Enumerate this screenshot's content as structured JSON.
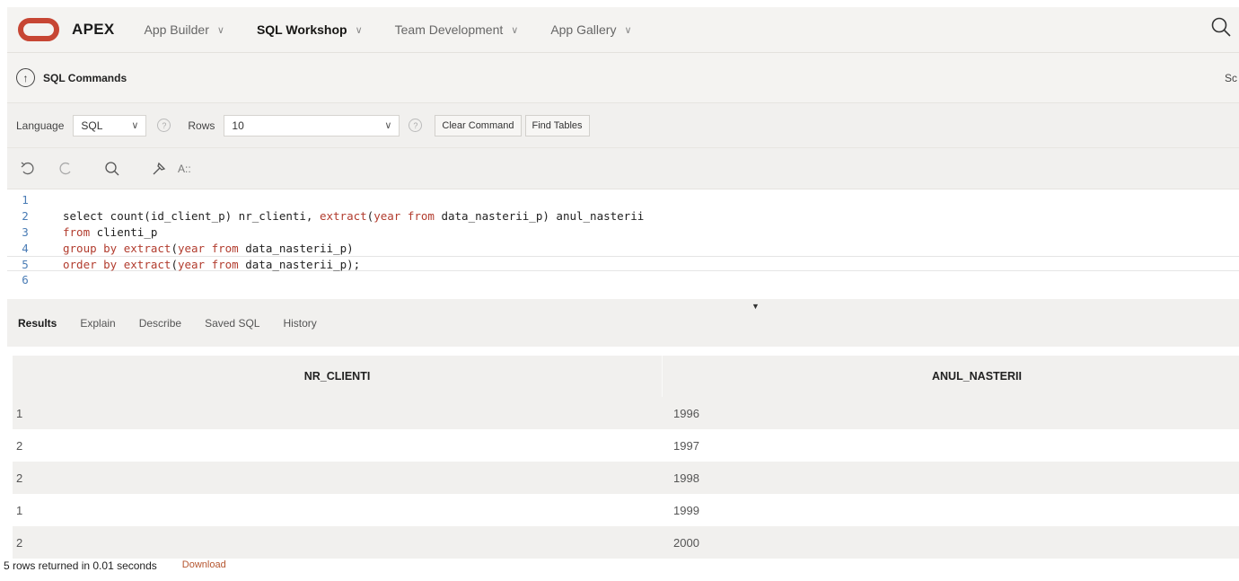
{
  "nav": {
    "brand": "APEX",
    "items": [
      {
        "label": "App Builder",
        "active": false
      },
      {
        "label": "SQL Workshop",
        "active": true
      },
      {
        "label": "Team Development",
        "active": false
      },
      {
        "label": "App Gallery",
        "active": false
      }
    ],
    "brand_color": "#c74634"
  },
  "page": {
    "title": "SQL Commands",
    "right_text": "Sc"
  },
  "toolbar": {
    "language_label": "Language",
    "language_value": "SQL",
    "rows_label": "Rows",
    "rows_value": "10",
    "clear_command": "Clear Command",
    "find_tables": "Find Tables"
  },
  "editor": {
    "lines": [
      {
        "num": "1",
        "code": ""
      },
      {
        "num": "2",
        "code": "select count(id_client_p) nr_clienti, extract(year from data_nasterii_p) anul_nasterii"
      },
      {
        "num": "3",
        "code": "from clienti_p"
      },
      {
        "num": "4",
        "code": "group by extract(year from data_nasterii_p)"
      },
      {
        "num": "5",
        "code": "order by extract(year from data_nasterii_p);"
      },
      {
        "num": "6",
        "code": ""
      }
    ]
  },
  "tabs": [
    "Results",
    "Explain",
    "Describe",
    "Saved SQL",
    "History"
  ],
  "results": {
    "columns": [
      "NR_CLIENTI",
      "ANUL_NASTERII"
    ],
    "rows": [
      [
        "1",
        "1996"
      ],
      [
        "2",
        "1997"
      ],
      [
        "2",
        "1998"
      ],
      [
        "1",
        "1999"
      ],
      [
        "2",
        "2000"
      ]
    ]
  },
  "footer": {
    "status": "5 rows returned in 0.01 seconds",
    "download": "Download"
  }
}
